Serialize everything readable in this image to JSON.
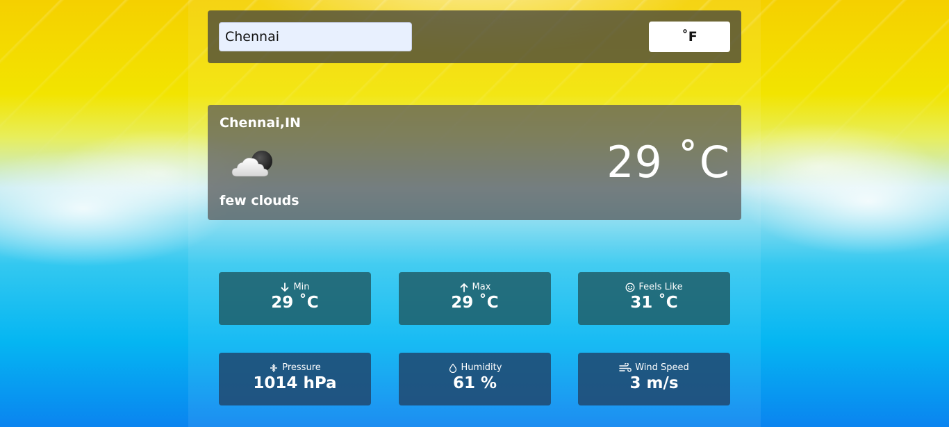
{
  "search": {
    "city_value": "Chennai"
  },
  "unit_toggle": {
    "label": "˚F"
  },
  "current": {
    "location": "Chennai,IN",
    "icon": "few-clouds-icon",
    "description": "few clouds",
    "temperature": "29 ˚C"
  },
  "stats": [
    {
      "icon": "arrow-down-icon",
      "label": "Min",
      "value": "29 ˚C"
    },
    {
      "icon": "arrow-up-icon",
      "label": "Max",
      "value": "29 ˚C"
    },
    {
      "icon": "smiley-icon",
      "label": "Feels Like",
      "value": "31 ˚C"
    },
    {
      "icon": "pressure-icon",
      "label": "Pressure",
      "value": "1014 hPa"
    },
    {
      "icon": "droplet-icon",
      "label": "Humidity",
      "value": "61 %"
    },
    {
      "icon": "wind-icon",
      "label": "Wind Speed",
      "value": "3 m/s"
    }
  ],
  "colors": {
    "search_bar_bg": "#46463c",
    "card_bg": "#5a5a5a",
    "stat_row1_bg": "#1e5a64",
    "stat_row2_bg": "#20486e",
    "text": "#ffffff"
  }
}
